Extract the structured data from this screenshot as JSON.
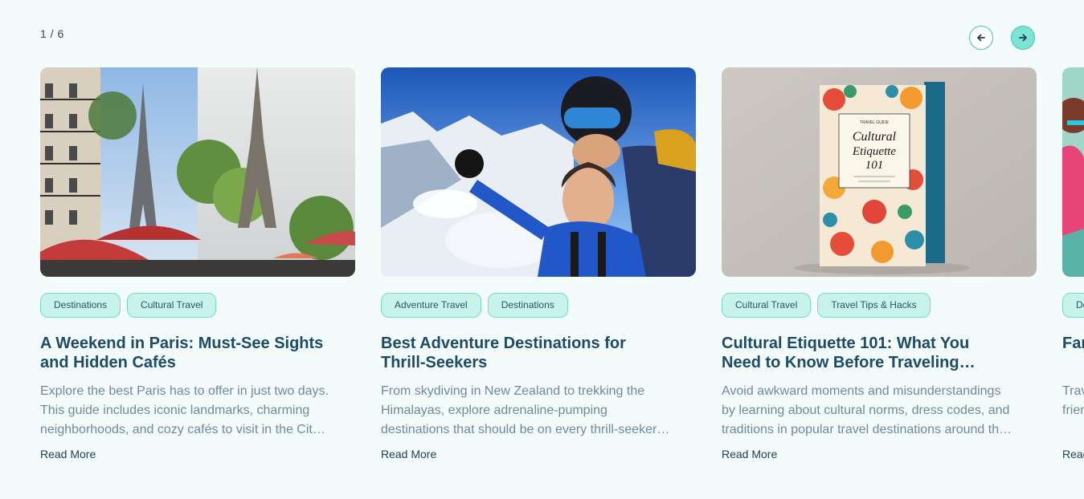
{
  "slider": {
    "counter": "1 / 6"
  },
  "icons": {
    "prev": "arrow-left-icon",
    "next": "arrow-right-icon"
  },
  "colors": {
    "accent": "#3fc6b3",
    "tag_bg": "#c8f3eb",
    "title": "#1d4a66",
    "background": "#f3fcfb"
  },
  "cards": [
    {
      "tags": [
        "Destinations",
        "Cultural Travel"
      ],
      "title": "A Weekend in Paris: Must-See Sights and Hidden Cafés",
      "excerpt": "Explore the best Paris has to offer in just two days. This guide includes iconic landmarks, charming neighborhoods, and cozy cafés to visit in the City of Light.",
      "read_more": "Read More"
    },
    {
      "tags": [
        "Adventure Travel",
        "Destinations"
      ],
      "title": "Best Adventure Destinations for Thrill-Seekers",
      "excerpt": "From skydiving in New Zealand to trekking the Himalayas, explore adrenaline-pumping destinations that should be on every thrill-seeker's bucket list.",
      "read_more": "Read More"
    },
    {
      "tags": [
        "Cultural Travel",
        "Travel Tips & Hacks"
      ],
      "title": "Cultural Etiquette 101: What You Need to Know Before Traveling Abroad",
      "excerpt": "Avoid awkward moments and misunderstandings by learning about cultural norms, dress codes, and traditions in popular travel destinations around the world.",
      "read_more": "Read More",
      "book": {
        "top_text": "TRAVEL GUIDE",
        "title_line1": "Cultural",
        "title_line2": "Etiquette",
        "title_line3": "101"
      }
    },
    {
      "tags": [
        "Destinations"
      ],
      "title": "Family-Friendly Destinations",
      "excerpt": "Travel with kids made easy: an overview of family-friendly destinations",
      "read_more": "Read More"
    }
  ]
}
